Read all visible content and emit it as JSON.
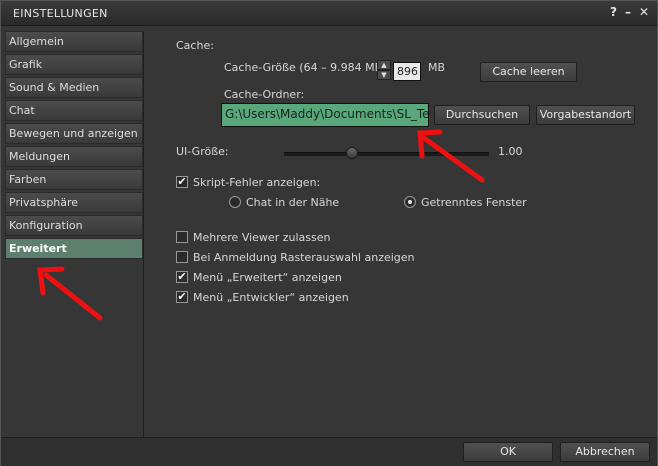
{
  "window": {
    "title": "EINSTELLUNGEN",
    "help": "?",
    "minimize": "–",
    "close": "✕"
  },
  "sidebar": {
    "items": [
      {
        "label": "Allgemein",
        "active": false
      },
      {
        "label": "Grafik",
        "active": false
      },
      {
        "label": "Sound & Medien",
        "active": false
      },
      {
        "label": "Chat",
        "active": false
      },
      {
        "label": "Bewegen und anzeigen",
        "active": false
      },
      {
        "label": "Meldungen",
        "active": false
      },
      {
        "label": "Farben",
        "active": false
      },
      {
        "label": "Privatsphäre",
        "active": false
      },
      {
        "label": "Konfiguration",
        "active": false
      },
      {
        "label": "Erweitert",
        "active": true
      }
    ]
  },
  "cache": {
    "heading": "Cache:",
    "size_label": "Cache-Größe (64 – 9.984 MB)",
    "size_value": "896",
    "size_unit": "MB",
    "clear_button": "Cache leeren",
    "folder_label": "Cache-Ordner:",
    "folder_value": "G:\\Users\\Maddy\\Documents\\SL_Te",
    "browse_button": "Durchsuchen",
    "default_button": "Vorgabestandort"
  },
  "ui_size": {
    "label": "UI-Größe:",
    "value_text": "1.00",
    "value": 1.0,
    "range": [
      0.75,
      1.5
    ]
  },
  "script_errors": {
    "label": "Skript-Fehler anzeigen:",
    "checked": true,
    "option_nearby": "Chat in der Nähe",
    "option_window": "Getrenntes Fenster",
    "selected": "Getrenntes Fenster"
  },
  "options": [
    {
      "label": "Mehrere Viewer zulassen",
      "checked": false
    },
    {
      "label": "Bei Anmeldung Rasterauswahl anzeigen",
      "checked": false
    },
    {
      "label": "Menü „Erweitert“ anzeigen",
      "checked": true
    },
    {
      "label": "Menü „Entwickler“ anzeigen",
      "checked": true
    }
  ],
  "footer": {
    "ok": "OK",
    "cancel": "Abbrechen"
  },
  "check_glyph": "✔",
  "colors": {
    "active_tab": "#5d7f6d",
    "path_field": "#5aa77c",
    "annotation_arrow": "#ee1111"
  }
}
